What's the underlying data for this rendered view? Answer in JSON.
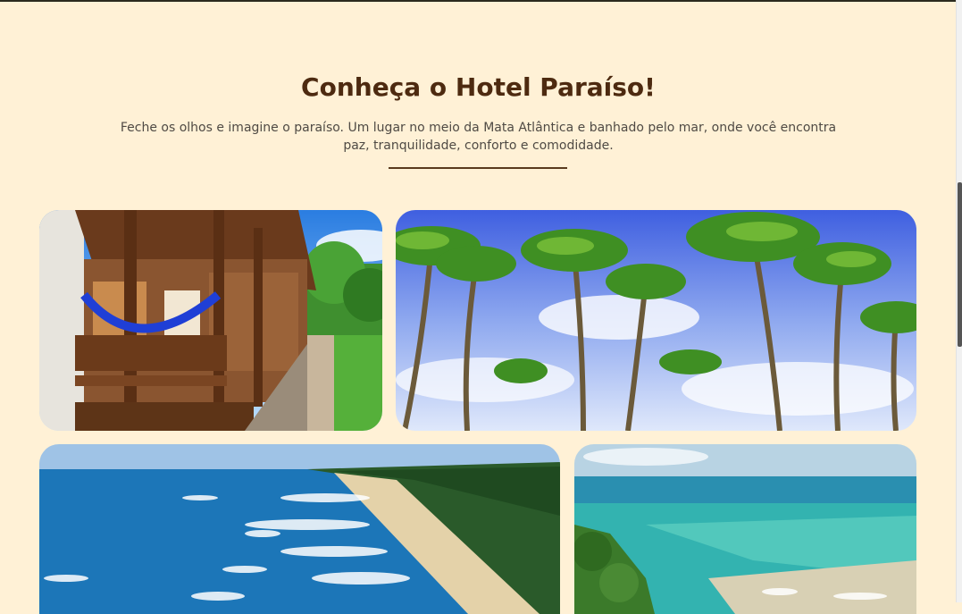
{
  "hero": {
    "title": "Conheça o Hotel Paraíso!",
    "description": "Feche os olhos e imagine o paraíso. Um lugar no meio da Mata Atlântica e banhado pelo mar, onde você encontra paz, tranquilidade, conforto e comodidade."
  },
  "colors": {
    "background": "#fff1d6",
    "title": "#4d2a10",
    "text": "#4f4a44",
    "divider": "#5a3a1e"
  },
  "gallery": {
    "photos": [
      {
        "subject": "hotel-balcony-hammocks"
      },
      {
        "subject": "coconut-palm-trees-sky"
      },
      {
        "subject": "aerial-beach-coastline"
      },
      {
        "subject": "turquoise-sea-cliff"
      }
    ]
  }
}
